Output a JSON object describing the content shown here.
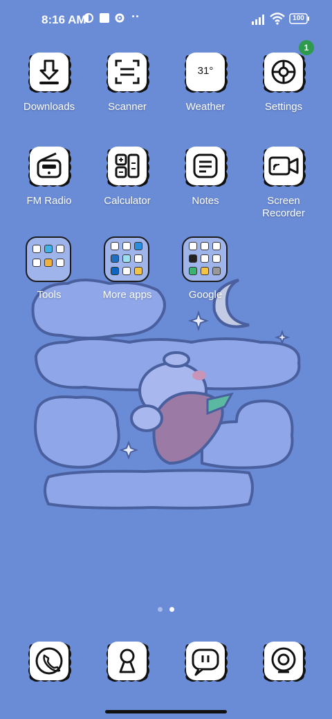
{
  "status": {
    "time": "8:16 AM",
    "more": "··",
    "battery": "100"
  },
  "apps": [
    {
      "id": "downloads",
      "label": "Downloads",
      "icon": "download-icon"
    },
    {
      "id": "scanner",
      "label": "Scanner",
      "icon": "scanner-icon"
    },
    {
      "id": "weather",
      "label": "Weather",
      "icon": "weather-icon",
      "icon_text": "31°"
    },
    {
      "id": "settings",
      "label": "Settings",
      "icon": "settings-icon",
      "badge": "1"
    },
    {
      "id": "fm-radio",
      "label": "FM Radio",
      "icon": "radio-icon"
    },
    {
      "id": "calculator",
      "label": "Calculator",
      "icon": "calculator-icon"
    },
    {
      "id": "notes",
      "label": "Notes",
      "icon": "notes-icon"
    },
    {
      "id": "screen-recorder",
      "label": "Screen\nRecorder",
      "icon": "screen-recorder-icon"
    }
  ],
  "folders": [
    {
      "id": "tools",
      "label": "Tools"
    },
    {
      "id": "more-apps",
      "label": "More apps"
    },
    {
      "id": "google",
      "label": "Google"
    }
  ],
  "dock": [
    {
      "id": "phone",
      "icon": "phone-icon"
    },
    {
      "id": "security",
      "icon": "keyhole-icon"
    },
    {
      "id": "messages",
      "icon": "message-icon"
    },
    {
      "id": "camera",
      "icon": "camera-icon"
    }
  ],
  "page_indicator": {
    "total": 2,
    "current": 2
  },
  "colors": {
    "background": "#6a8bd6",
    "cloud": "#8fa7e8",
    "cloud_outline": "#4a5f9e",
    "badge": "#2e9a4e"
  }
}
